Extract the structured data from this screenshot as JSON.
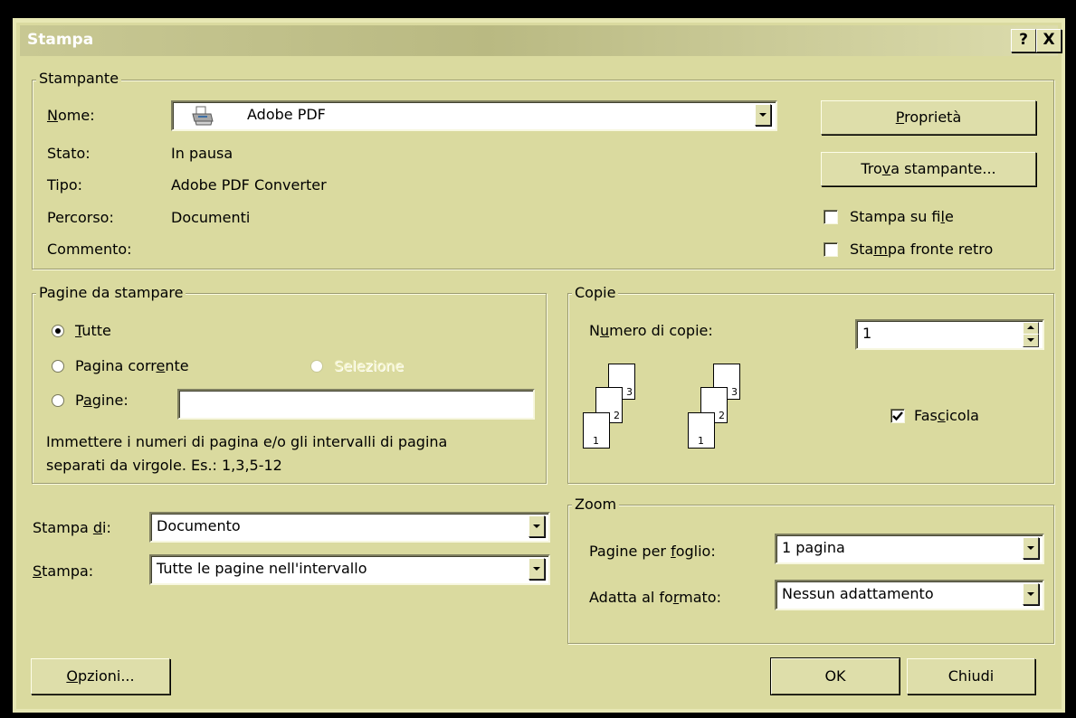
{
  "window": {
    "title": "Stampa",
    "help_label": "?",
    "close_label": "X"
  },
  "printer": {
    "legend": "Stampante",
    "name_label": "Nome:",
    "name_value": "Adobe PDF",
    "status_label": "Stato:",
    "status_value": "In pausa",
    "type_label": "Tipo:",
    "type_value": "Adobe PDF Converter",
    "path_label": "Percorso:",
    "path_value": "Documenti",
    "comment_label": "Commento:",
    "comment_value": "",
    "properties_button": "Proprietà",
    "find_printer_button": "Trova stampante...",
    "print_to_file_label": "Stampa su file",
    "print_to_file_checked": false,
    "duplex_label": "Stampa fronte retro",
    "duplex_checked": false
  },
  "page_range": {
    "legend": "Pagine da stampare",
    "all_label": "Tutte",
    "current_label": "Pagina corrente",
    "selection_label": "Selezione",
    "pages_label": "Pagine:",
    "pages_value": "",
    "selected": "all",
    "hint_line1": "Immettere i numeri di pagina e/o gli intervalli di pagina",
    "hint_line2": "separati da virgole. Es.: 1,3,5-12"
  },
  "copies": {
    "legend": "Copie",
    "count_label": "Numero di copie:",
    "count_value": "1",
    "collate_label": "Fascicola",
    "collate_checked": true,
    "page_numbers": [
      "1",
      "2",
      "3"
    ]
  },
  "print_what": {
    "print_of_label": "Stampa di:",
    "print_of_value": "Documento",
    "print_label": "Stampa:",
    "print_value": "Tutte le pagine nell'intervallo"
  },
  "zoom": {
    "legend": "Zoom",
    "pages_per_sheet_label": "Pagine per foglio:",
    "pages_per_sheet_value": "1 pagina",
    "scale_label": "Adatta al formato:",
    "scale_value": "Nessun adattamento"
  },
  "footer": {
    "options_button": "Opzioni...",
    "ok_button": "OK",
    "close_button": "Chiudi"
  },
  "colors": {
    "dialog_bg": "#dada9f",
    "title_text": "#ffffff",
    "disabled_text": "#f4f4c8"
  }
}
